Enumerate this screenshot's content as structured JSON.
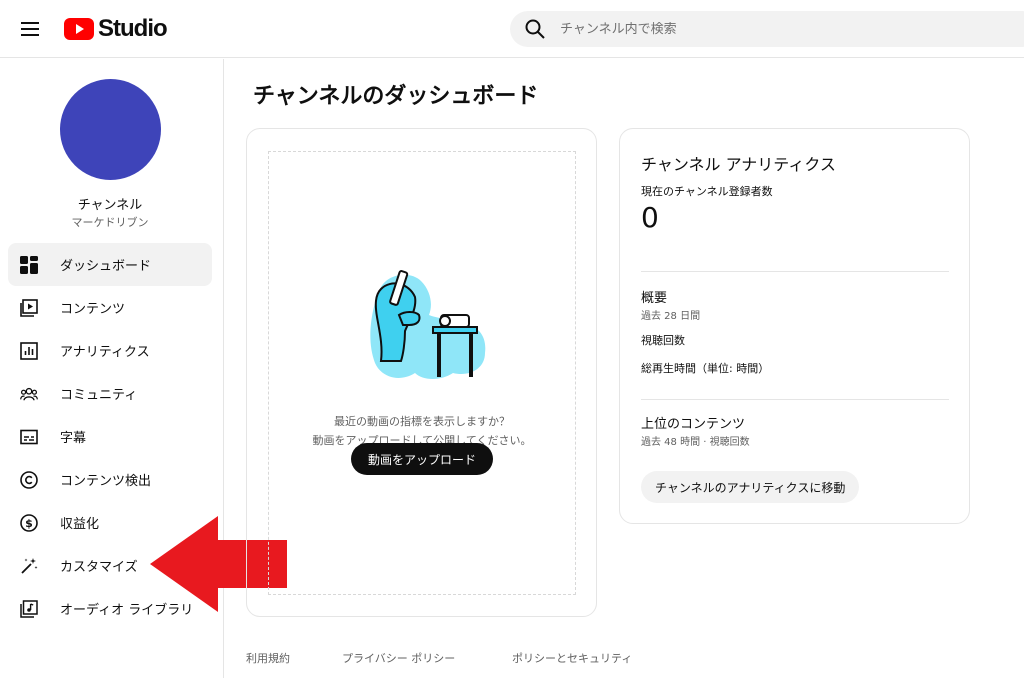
{
  "header": {
    "logo_text": "Studio",
    "search_placeholder": "チャンネル内で検索"
  },
  "sidebar": {
    "channel_name": "チャンネル",
    "channel_handle": "マーケドリブン",
    "items": [
      {
        "label": "ダッシュボード",
        "icon": "dashboard-icon",
        "active": true
      },
      {
        "label": "コンテンツ",
        "icon": "content-icon"
      },
      {
        "label": "アナリティクス",
        "icon": "analytics-icon"
      },
      {
        "label": "コミュニティ",
        "icon": "community-icon"
      },
      {
        "label": "字幕",
        "icon": "subtitles-icon"
      },
      {
        "label": "コンテンツ検出",
        "icon": "copyright-icon"
      },
      {
        "label": "収益化",
        "icon": "monetization-icon"
      },
      {
        "label": "カスタマイズ",
        "icon": "customize-wand-icon"
      },
      {
        "label": "オーディオ ライブラリ",
        "icon": "audio-library-icon"
      }
    ]
  },
  "main": {
    "title": "チャンネルのダッシュボード",
    "upload_card": {
      "message_line1": "最近の動画の指標を表示しますか？",
      "message_line2": "動画をアップロードして公開してください。",
      "button": "動画をアップロード"
    },
    "analytics_card": {
      "title": "チャンネル アナリティクス",
      "subscribers_label": "現在のチャンネル登録者数",
      "subscribers_count": "0",
      "summary_title": "概要",
      "summary_period": "過去 28 日間",
      "views_label": "視聴回数",
      "watch_time_label": "総再生時間（単位: 時間）",
      "top_content_title": "上位のコンテンツ",
      "top_content_period": "過去 48 時間 · 視聴回数",
      "button": "チャンネルのアナリティクスに移動"
    }
  },
  "footer": {
    "links": [
      "利用規約",
      "プライバシー ポリシー",
      "ポリシーとセキュリティ"
    ]
  },
  "colors": {
    "brand_red": "#ff0000",
    "avatar": "#3e44b9",
    "annotation_arrow": "#e8191f",
    "illustration_cyan": "#3fd0ef"
  }
}
